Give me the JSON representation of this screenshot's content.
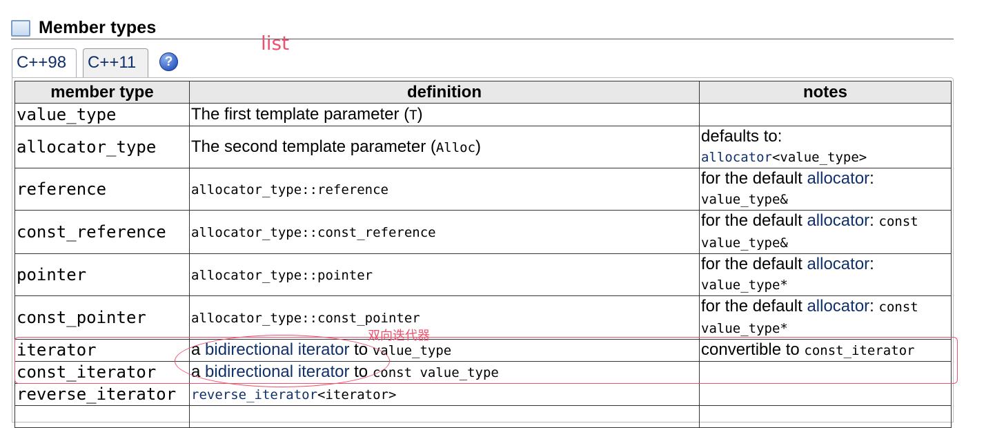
{
  "header": {
    "title": "Member types"
  },
  "annotations": {
    "list_label": "list",
    "chinese_label": "双向迭代器",
    "color": "#f0506e"
  },
  "tabs": [
    {
      "label": "C++98",
      "active": true
    },
    {
      "label": "C++11",
      "active": false
    }
  ],
  "help": {
    "icon": "help-icon",
    "glyph": "?"
  },
  "table": {
    "headers": {
      "member_type": "member type",
      "definition": "definition",
      "notes": "notes"
    },
    "rows": [
      {
        "member": "value_type",
        "def": {
          "pre": "The first template parameter (",
          "code": "T",
          "post": ")"
        },
        "notes": null
      },
      {
        "member": "allocator_type",
        "def": {
          "pre": "The second template parameter (",
          "code": "Alloc",
          "post": ")"
        },
        "notes": {
          "text": "defaults to:",
          "link": "allocator",
          "code": "<value_type>"
        }
      },
      {
        "member": "reference",
        "def": {
          "code": "allocator_type::reference"
        },
        "notes": {
          "text": "for the default ",
          "link": "allocator",
          "colon": ":",
          "code": "value_type&"
        }
      },
      {
        "member": "const_reference",
        "def": {
          "code": "allocator_type::const_reference"
        },
        "notes": {
          "text": "for the default ",
          "link": "allocator",
          "colon": ":",
          "code": "const value_type&"
        }
      },
      {
        "member": "pointer",
        "def": {
          "code": "allocator_type::pointer"
        },
        "notes": {
          "text": "for the default ",
          "link": "allocator",
          "colon": ":",
          "code": "value_type*"
        }
      },
      {
        "member": "const_pointer",
        "def": {
          "code": "allocator_type::const_pointer"
        },
        "notes": {
          "text": "for the default ",
          "link": "allocator",
          "colon": ":",
          "code": "const value_type*"
        }
      },
      {
        "member": "iterator",
        "def": {
          "pre": "a ",
          "link": "bidirectional iterator",
          "mid": " to ",
          "code": "value_type"
        },
        "notes": {
          "text": "convertible to ",
          "code": "const_iterator"
        }
      },
      {
        "member": "const_iterator",
        "def": {
          "pre": "a ",
          "link": "bidirectional iterator",
          "mid": " to ",
          "code": "const value_type"
        },
        "notes": null
      },
      {
        "member": "reverse_iterator",
        "def": {
          "link": "reverse_iterator",
          "code": "<iterator>"
        },
        "notes": null
      }
    ]
  }
}
